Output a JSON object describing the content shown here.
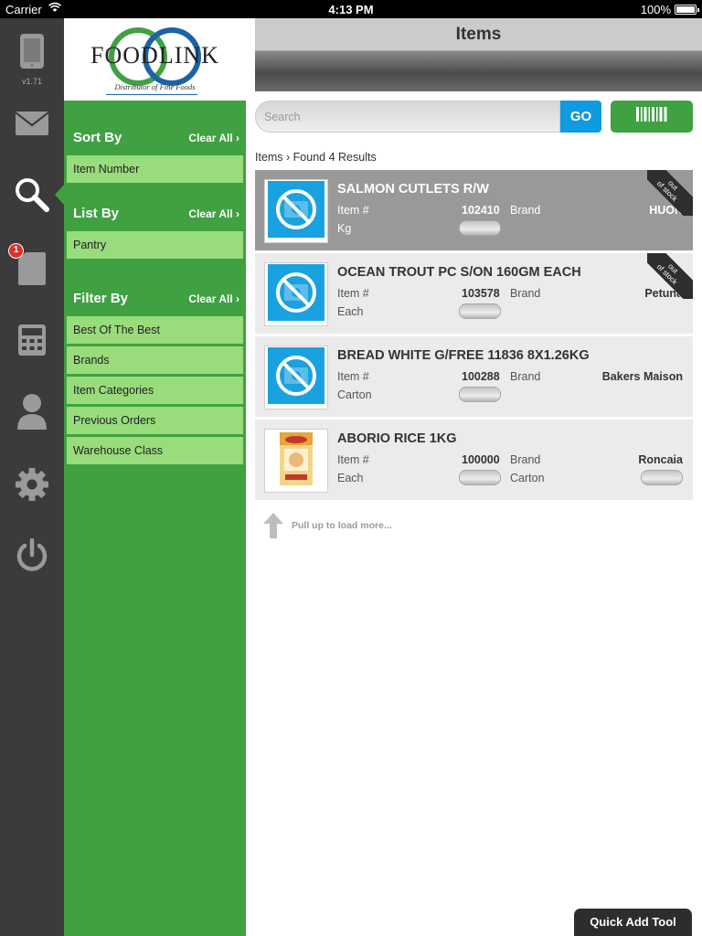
{
  "status_bar": {
    "carrier": "Carrier",
    "time": "4:13 PM",
    "battery": "100%"
  },
  "rail": {
    "version": "v1.71",
    "badge_count": "1",
    "items": [
      {
        "icon": "tablet-icon"
      },
      {
        "icon": "mail-icon"
      },
      {
        "icon": "search-icon"
      },
      {
        "icon": "document-icon"
      },
      {
        "icon": "calculator-icon"
      },
      {
        "icon": "user-icon"
      },
      {
        "icon": "gear-icon"
      },
      {
        "icon": "power-icon"
      }
    ]
  },
  "logo": {
    "word": "FOODLINK",
    "tagline": "Distributor of Fine Foods"
  },
  "filters": {
    "sort_by": {
      "title": "Sort By",
      "clear": "Clear All ›",
      "options": [
        "Item Number"
      ]
    },
    "list_by": {
      "title": "List By",
      "clear": "Clear All ›",
      "options": [
        "Pantry"
      ]
    },
    "filter_by": {
      "title": "Filter By",
      "clear": "Clear All ›",
      "options": [
        "Best Of The Best",
        "Brands",
        "Item Categories",
        "Previous Orders",
        "Warehouse Class"
      ]
    }
  },
  "header": {
    "title": "Items"
  },
  "search": {
    "placeholder": "Search",
    "go_label": "GO"
  },
  "breadcrumb": "Items › Found 4 Results",
  "items": [
    {
      "name": "SALMON CUTLETS R/W",
      "item_label": "Item #",
      "item_number": "102410",
      "brand_label": "Brand",
      "brand": "HUON",
      "unit": "Kg",
      "out_of_stock": "out of stock"
    },
    {
      "name": "OCEAN TROUT PC S/ON 160GM EACH",
      "item_label": "Item #",
      "item_number": "103578",
      "brand_label": "Brand",
      "brand": "Petuna",
      "unit": "Each",
      "out_of_stock": "out of stock"
    },
    {
      "name": "BREAD WHITE G/FREE 11836 8X1.26KG",
      "item_label": "Item #",
      "item_number": "100288",
      "brand_label": "Brand",
      "brand": "Bakers Maison",
      "unit": "Carton"
    },
    {
      "name": "ABORIO RICE 1KG",
      "item_label": "Item #",
      "item_number": "100000",
      "brand_label": "Brand",
      "brand": "Roncaia",
      "unit": "Each",
      "unit2": "Carton"
    }
  ],
  "pull_up_text": "Pull up to load more...",
  "quick_add_label": "Quick Add Tool",
  "colors": {
    "green": "#3fa142",
    "light_green": "#99dc7c",
    "rail": "#3b3b3b",
    "blue": "#0f9be0"
  }
}
